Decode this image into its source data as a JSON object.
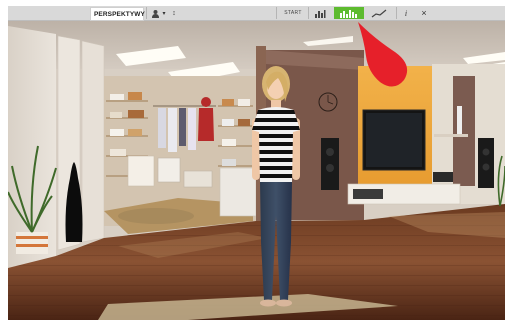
{
  "toolbar": {
    "logo_text": "PERSPEKTYWY",
    "start_label": "START",
    "icons": {
      "user": "user-icon",
      "user_menu": "chevron-icon",
      "pin": "pin-icon",
      "chart_bars": "bar-chart-icon",
      "chart_active": "bar-chart-active-icon",
      "trend": "trend-line-icon",
      "info": "info-icon",
      "close": "close-icon"
    },
    "close_glyph": "×",
    "info_glyph": "i",
    "user_menu_glyph": "▾",
    "pin_glyph": "↕"
  },
  "colors": {
    "active": "#5dbb2f",
    "pointer": "#e6202a"
  }
}
